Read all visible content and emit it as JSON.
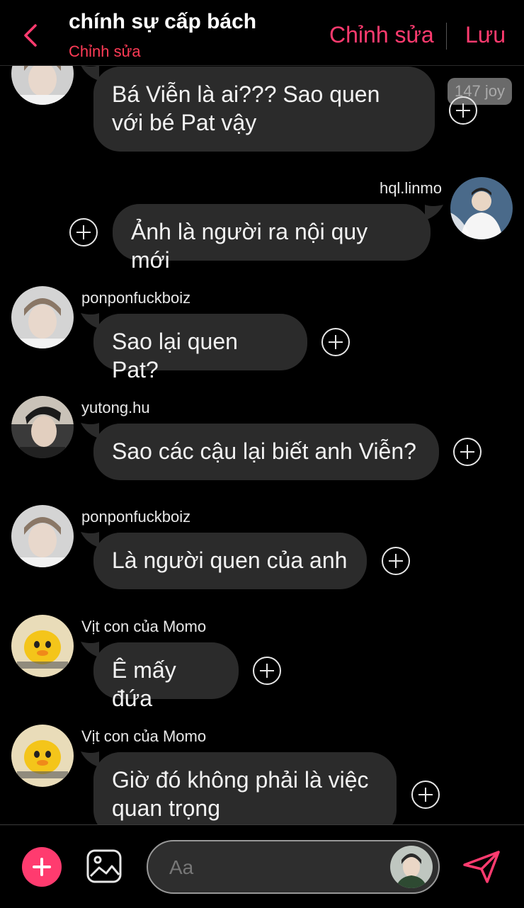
{
  "header": {
    "title": "chính sự cấp bách",
    "subtitle": "Chỉnh sửa",
    "edit_label": "Chỉnh sửa",
    "save_label": "Lưu"
  },
  "messages": [
    {
      "sender": "",
      "avatar": "pon",
      "text": "Bá Viễn là ai??? Sao quen với bé Pat vậy",
      "reaction": "147 joy"
    },
    {
      "sender": "hql.linmo",
      "avatar": "linmo",
      "text": "Ảnh là người ra nội quy mới",
      "self": true
    },
    {
      "sender": "ponponfuckboiz",
      "avatar": "pon",
      "text": "Sao lại quen Pat?"
    },
    {
      "sender": "yutong.hu",
      "avatar": "yutong",
      "text": "Sao các cậu lại biết anh Viễn?"
    },
    {
      "sender": "ponponfuckboiz",
      "avatar": "pon",
      "text": "Là người quen của anh"
    },
    {
      "sender": "Vịt con của Momo",
      "avatar": "duck",
      "text": "Ê mấy đứa"
    },
    {
      "sender": "Vịt con của Momo",
      "avatar": "duck",
      "text": "Giờ đó không phải là việc quan trọng"
    }
  ],
  "composer": {
    "placeholder": "Aa"
  },
  "colors": {
    "accent": "#ff3b6f",
    "bubble": "#2b2b2b",
    "background": "#000000"
  }
}
